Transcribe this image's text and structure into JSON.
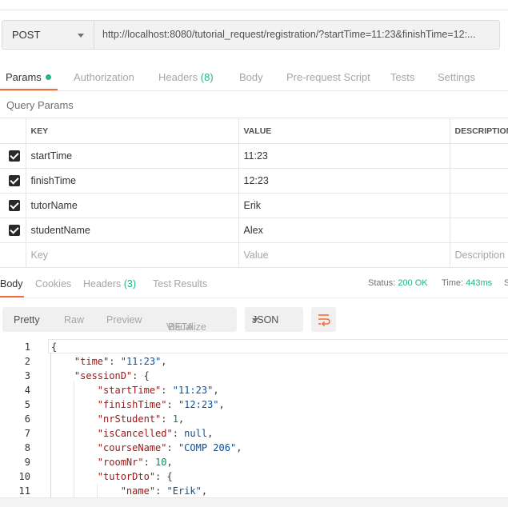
{
  "request": {
    "method": "POST",
    "url": "http://localhost:8080/tutorial_request/registration/?startTime=11:23&finishTime=12:..."
  },
  "request_tabs": {
    "params": "Params",
    "authorization": "Authorization",
    "headers": "Headers",
    "headers_count": "(8)",
    "body": "Body",
    "prerequest": "Pre-request Script",
    "tests": "Tests",
    "settings": "Settings"
  },
  "query_params": {
    "title": "Query Params",
    "columns": [
      "KEY",
      "VALUE",
      "DESCRIPTION"
    ],
    "rows": [
      {
        "key": "startTime",
        "value": "11:23"
      },
      {
        "key": "finishTime",
        "value": "12:23"
      },
      {
        "key": "tutorName",
        "value": "Erik"
      },
      {
        "key": "studentName",
        "value": "Alex"
      }
    ],
    "placeholder": {
      "key": "Key",
      "value": "Value",
      "description": "Description"
    }
  },
  "response_tabs": {
    "body": "Body",
    "cookies": "Cookies",
    "headers": "Headers",
    "headers_count": "(3)",
    "test_results": "Test Results"
  },
  "response_status": {
    "status_label": "Status:",
    "status_value": "200 OK",
    "time_label": "Time:",
    "time_value": "443ms",
    "cut": "S"
  },
  "view_modes": {
    "pretty": "Pretty",
    "raw": "Raw",
    "preview": "Preview",
    "visualize": "Visualize",
    "beta": "BETA",
    "format": "JSON"
  },
  "code_lines": [
    {
      "n": "1",
      "indent": "",
      "parts": [
        {
          "t": "p",
          "v": "{"
        }
      ]
    },
    {
      "n": "2",
      "indent": "    ",
      "parts": [
        {
          "t": "k",
          "v": "\"time\""
        },
        {
          "t": "p",
          "v": ": "
        },
        {
          "t": "s",
          "v": "\"11:23\""
        },
        {
          "t": "p",
          "v": ","
        }
      ]
    },
    {
      "n": "3",
      "indent": "    ",
      "parts": [
        {
          "t": "k",
          "v": "\"sessionD\""
        },
        {
          "t": "p",
          "v": ": {"
        }
      ]
    },
    {
      "n": "4",
      "indent": "        ",
      "parts": [
        {
          "t": "k",
          "v": "\"startTime\""
        },
        {
          "t": "p",
          "v": ": "
        },
        {
          "t": "s",
          "v": "\"11:23\""
        },
        {
          "t": "p",
          "v": ","
        }
      ]
    },
    {
      "n": "5",
      "indent": "        ",
      "parts": [
        {
          "t": "k",
          "v": "\"finishTime\""
        },
        {
          "t": "p",
          "v": ": "
        },
        {
          "t": "s",
          "v": "\"12:23\""
        },
        {
          "t": "p",
          "v": ","
        }
      ]
    },
    {
      "n": "6",
      "indent": "        ",
      "parts": [
        {
          "t": "k",
          "v": "\"nrStudent\""
        },
        {
          "t": "p",
          "v": ": "
        },
        {
          "t": "n",
          "v": "1"
        },
        {
          "t": "p",
          "v": ","
        }
      ]
    },
    {
      "n": "7",
      "indent": "        ",
      "parts": [
        {
          "t": "k",
          "v": "\"isCancelled\""
        },
        {
          "t": "p",
          "v": ": "
        },
        {
          "t": "kw",
          "v": "null"
        },
        {
          "t": "p",
          "v": ","
        }
      ]
    },
    {
      "n": "8",
      "indent": "        ",
      "parts": [
        {
          "t": "k",
          "v": "\"courseName\""
        },
        {
          "t": "p",
          "v": ": "
        },
        {
          "t": "s",
          "v": "\"COMP 206\""
        },
        {
          "t": "p",
          "v": ","
        }
      ]
    },
    {
      "n": "9",
      "indent": "        ",
      "parts": [
        {
          "t": "k",
          "v": "\"roomNr\""
        },
        {
          "t": "p",
          "v": ": "
        },
        {
          "t": "n",
          "v": "10"
        },
        {
          "t": "p",
          "v": ","
        }
      ]
    },
    {
      "n": "10",
      "indent": "        ",
      "parts": [
        {
          "t": "k",
          "v": "\"tutorDto\""
        },
        {
          "t": "p",
          "v": ": {"
        }
      ]
    },
    {
      "n": "11",
      "indent": "            ",
      "parts": [
        {
          "t": "k",
          "v": "\"name\""
        },
        {
          "t": "p",
          "v": ": "
        },
        {
          "t": "s",
          "v": "\"Erik\""
        },
        {
          "t": "p",
          "v": ","
        }
      ]
    }
  ],
  "colors": {
    "accent": "#f26b3a",
    "success": "#26b47f",
    "key": "#a31515",
    "string": "#0451a5",
    "number": "#098658"
  }
}
